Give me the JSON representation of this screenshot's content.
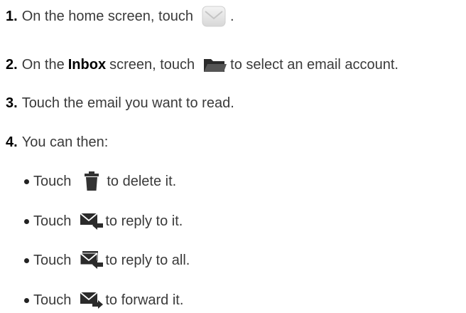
{
  "steps": [
    {
      "num": "1.",
      "text_before": "On the home screen, touch",
      "icon": "email-app-icon",
      "text_after": "."
    },
    {
      "num": "2.",
      "text_before": "On the",
      "bold": "Inbox",
      "text_mid": "screen, touch",
      "icon": "folder-icon",
      "text_after": "to select an email account."
    },
    {
      "num": "3.",
      "text": "Touch the email you want to read."
    },
    {
      "num": "4.",
      "text": "You can then:"
    }
  ],
  "bullets": [
    {
      "touch": "Touch",
      "icon": "trash-icon",
      "text": "to delete it."
    },
    {
      "touch": "Touch",
      "icon": "reply-icon",
      "text": "to reply to it."
    },
    {
      "touch": "Touch",
      "icon": "reply-all-icon",
      "text": "to reply to all."
    },
    {
      "touch": "Touch",
      "icon": "forward-icon",
      "text": "to forward it."
    }
  ],
  "colors": {
    "text": "#3a3a3a",
    "number": "#000000",
    "icon_dark": "#333333",
    "icon_light": "#e6e6e6"
  }
}
